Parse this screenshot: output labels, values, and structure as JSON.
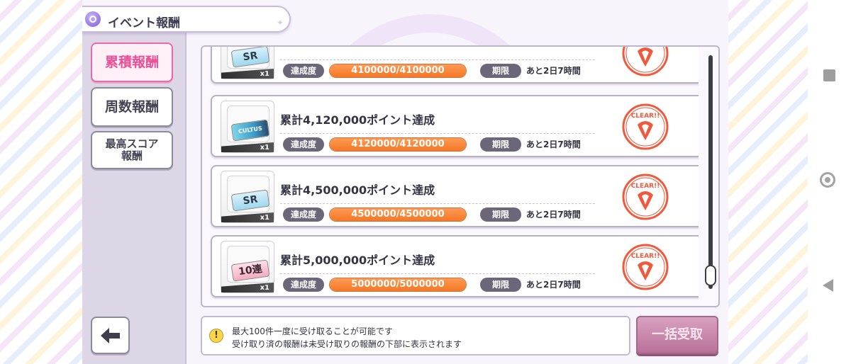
{
  "header": {
    "title": "イベント報酬",
    "sparkle": "✦"
  },
  "sidebar": {
    "items": [
      {
        "label": "累積報酬",
        "active": true
      },
      {
        "label": "周数報酬",
        "active": false
      },
      {
        "label": "最高スコア\n報酬",
        "active": false
      }
    ]
  },
  "rewards": [
    {
      "title": "",
      "item": "SR",
      "item_type": "gacha-ticket-sr",
      "quantity": "x1",
      "progress_label": "達成度",
      "progress_text": "4100000/4100000",
      "progress_fraction": 1.0,
      "deadline_label": "期限",
      "deadline": "あと2日7時間",
      "status": "CLEAR!!"
    },
    {
      "title": "累計4,120,000ポイント達成",
      "item": "CULTUS EVE",
      "item_type": "card",
      "quantity": "x1",
      "progress_label": "達成度",
      "progress_text": "4120000/4120000",
      "progress_fraction": 1.0,
      "deadline_label": "期限",
      "deadline": "あと2日7時間",
      "status": "CLEAR!!"
    },
    {
      "title": "累計4,500,000ポイント達成",
      "item": "SR",
      "item_type": "gacha-ticket-sr",
      "quantity": "x1",
      "progress_label": "達成度",
      "progress_text": "4500000/4500000",
      "progress_fraction": 1.0,
      "deadline_label": "期限",
      "deadline": "あと2日7時間",
      "status": "CLEAR!!"
    },
    {
      "title": "累計5,000,000ポイント達成",
      "item": "10連",
      "item_type": "gacha-ticket-10",
      "quantity": "x1",
      "progress_label": "達成度",
      "progress_text": "5000000/5000000",
      "progress_fraction": 1.0,
      "deadline_label": "期限",
      "deadline": "あと2日7時間",
      "status": "CLEAR!!"
    }
  ],
  "info": {
    "icon": "!",
    "line1": "最大100件一度に受け取ることが可能です",
    "line2": "受け取り済の報酬は未受け取りの報酬の下部に表示されます"
  },
  "bulk_receive_label": "一括受取",
  "colors": {
    "accent_pink": "#ea4f97",
    "progress_orange": "#f47824",
    "stamp_red": "#f05a3c"
  }
}
